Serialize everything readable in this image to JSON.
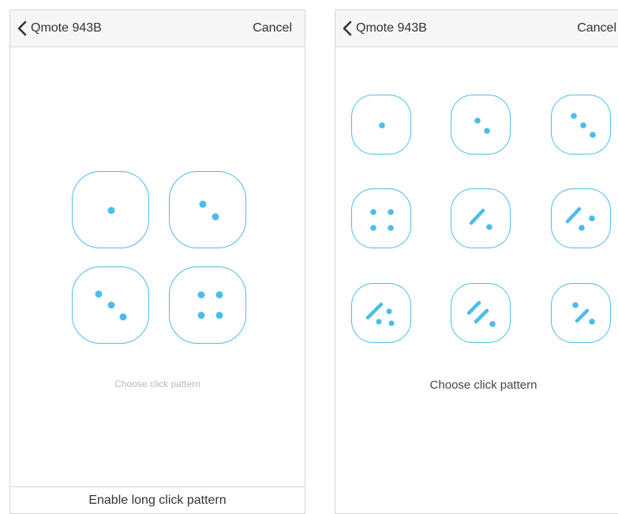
{
  "accent_color": "#4bbde8",
  "left_screen": {
    "nav": {
      "back_icon": "chevron-left-icon",
      "back_label": "Qmote 943B",
      "cancel_label": "Cancel"
    },
    "patterns": [
      "single-click",
      "double-click",
      "triple-click",
      "quadruple-click"
    ],
    "caption": "Choose click pattern",
    "footer_button": "Enable long click pattern"
  },
  "right_screen": {
    "nav": {
      "back_icon": "chevron-left-icon",
      "back_label": "Qmote 943B",
      "cancel_label": "Cancel"
    },
    "patterns": [
      "single-click",
      "double-click",
      "triple-click",
      "quadruple-click",
      "long-click",
      "long-click-then-click",
      "long-click-then-double-click",
      "double-long-click",
      "click-then-long-click"
    ],
    "caption": "Choose click pattern"
  }
}
